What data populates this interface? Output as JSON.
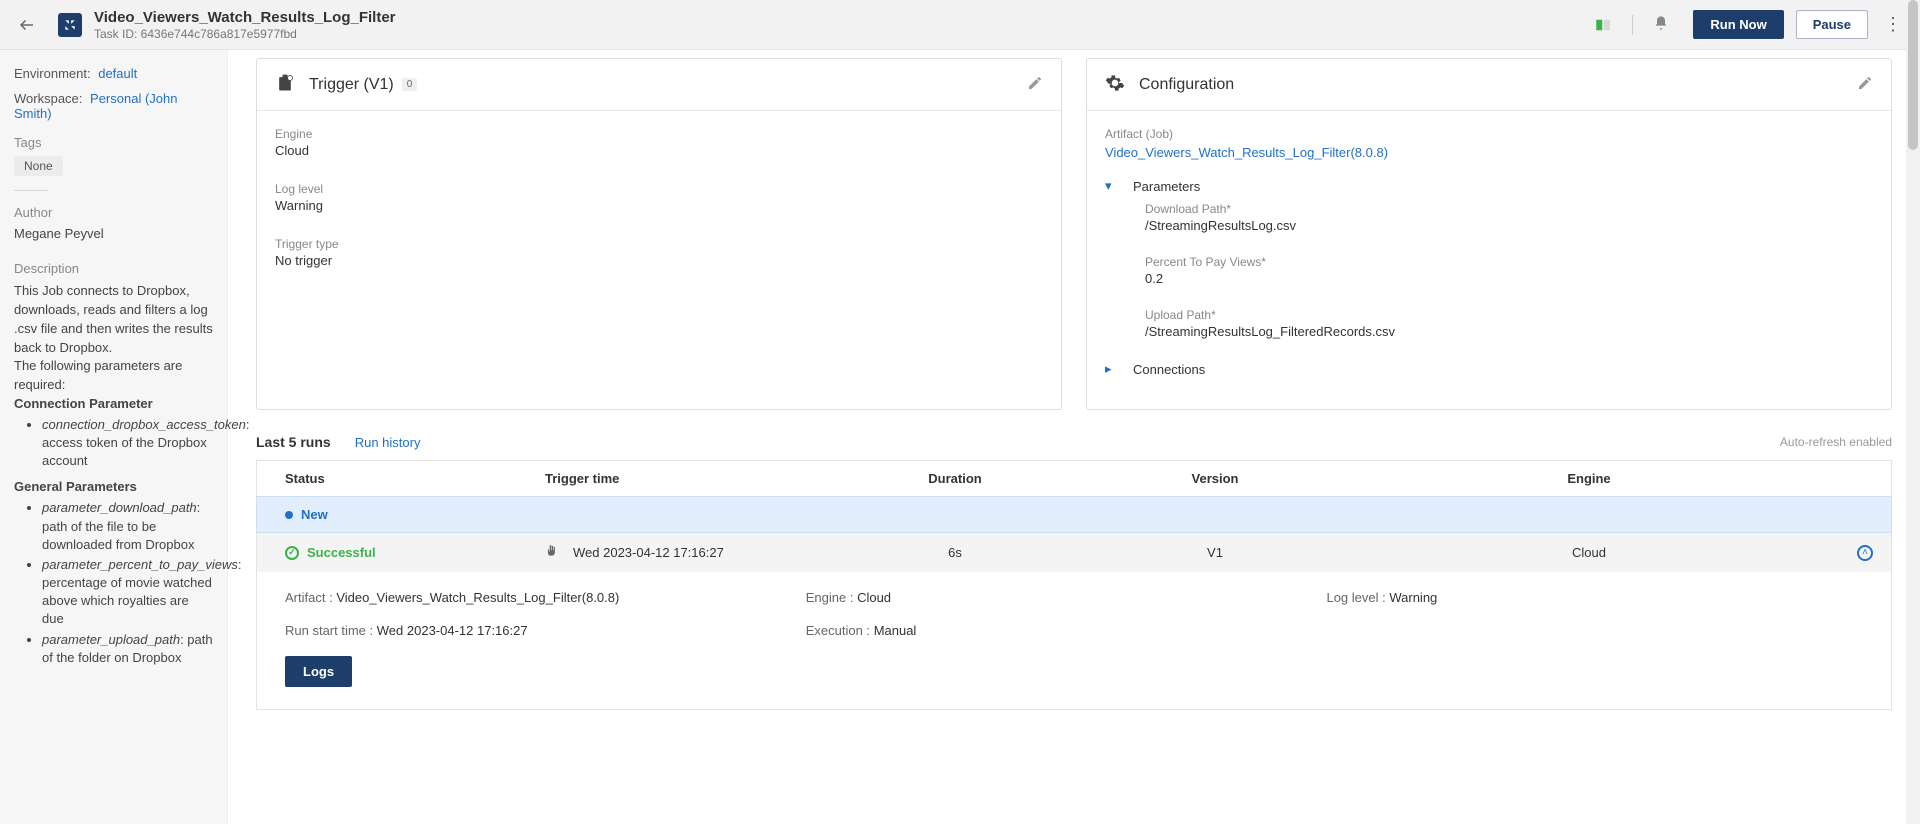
{
  "header": {
    "title": "Video_Viewers_Watch_Results_Log_Filter",
    "task_id_label": "Task ID: 6436e744c786a817e5977fbd",
    "run_now": "Run Now",
    "pause": "Pause"
  },
  "sidebar": {
    "env_label": "Environment:",
    "env_value": "default",
    "ws_label": "Workspace:",
    "ws_value": "Personal (John Smith)",
    "tags_label": "Tags",
    "tags_none": "None",
    "author_label": "Author",
    "author_value": "Megane Peyvel",
    "desc_label": "Description",
    "desc_intro": "This Job connects to Dropbox, downloads, reads and filters a log .csv file and then writes the results back to Dropbox.",
    "desc_params_intro": "The following parameters are required:",
    "conn_title": "Connection Parameter",
    "conn_item_key": "connection_dropbox_access_token",
    "conn_item_val": ": access token of the Dropbox account",
    "gen_title": "General Parameters",
    "gen_1_key": "parameter_download_path",
    "gen_1_val": ": path of the file to be downloaded from Dropbox",
    "gen_2_key": "parameter_percent_to_pay_views",
    "gen_2_val": ": percentage of movie watched above which royalties are due",
    "gen_3_key": "parameter_upload_path",
    "gen_3_val": ": path of the folder on Dropbox"
  },
  "trigger": {
    "title": "Trigger (V1)",
    "badge": "0",
    "engine_label": "Engine",
    "engine_value": "Cloud",
    "log_label": "Log level",
    "log_value": "Warning",
    "type_label": "Trigger type",
    "type_value": "No trigger"
  },
  "config": {
    "title": "Configuration",
    "artifact_label": "Artifact (Job)",
    "artifact_link": "Video_Viewers_Watch_Results_Log_Filter(8.0.8)",
    "params_label": "Parameters",
    "p1_label": "Download Path*",
    "p1_value": "/StreamingResultsLog.csv",
    "p2_label": "Percent To Pay Views*",
    "p2_value": "0.2",
    "p3_label": "Upload Path*",
    "p3_value": "/StreamingResultsLog_FilteredRecords.csv",
    "conn_label": "Connections"
  },
  "runs": {
    "title": "Last 5 runs",
    "history_link": "Run history",
    "auto_refresh": "Auto-refresh enabled",
    "th_status": "Status",
    "th_trigger": "Trigger time",
    "th_duration": "Duration",
    "th_version": "Version",
    "th_engine": "Engine",
    "new_label": "New",
    "row1": {
      "status": "Successful",
      "trigger": "Wed 2023-04-12 17:16:27",
      "duration": "6s",
      "version": "V1",
      "engine": "Cloud"
    },
    "detail": {
      "artifact_k": "Artifact :",
      "artifact_v": "Video_Viewers_Watch_Results_Log_Filter(8.0.8)",
      "engine_k": "Engine :",
      "engine_v": "Cloud",
      "log_k": "Log level :",
      "log_v": "Warning",
      "start_k": "Run start time :",
      "start_v": "Wed 2023-04-12 17:16:27",
      "exec_k": "Execution :",
      "exec_v": "Manual",
      "logs_btn": "Logs"
    }
  }
}
